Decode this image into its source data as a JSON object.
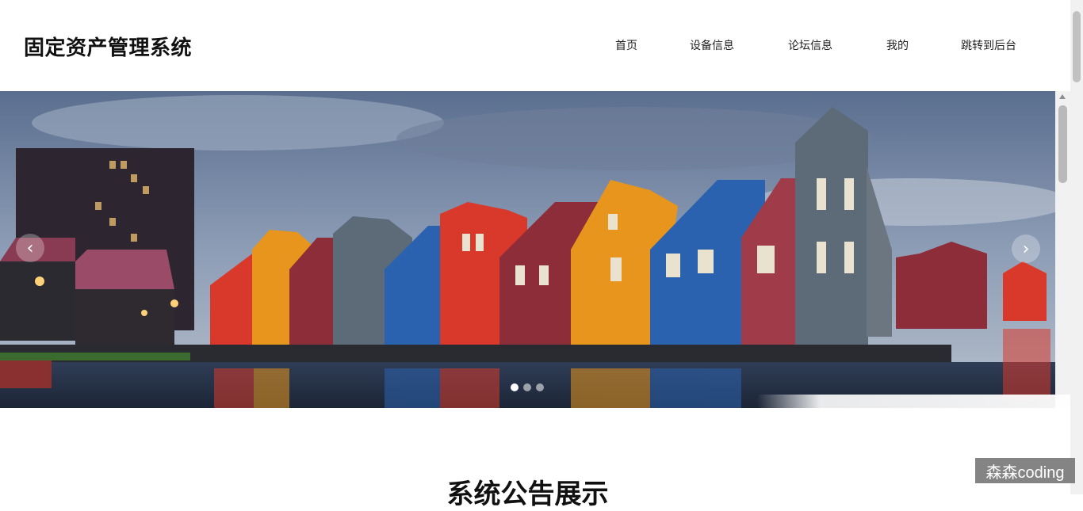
{
  "app": {
    "title": "固定资产管理系统"
  },
  "nav": {
    "items": [
      {
        "label": "首页"
      },
      {
        "label": "设备信息"
      },
      {
        "label": "论坛信息"
      },
      {
        "label": "我的"
      },
      {
        "label": "跳转到后台"
      }
    ]
  },
  "banner": {
    "prev_icon": "chevron-left-icon",
    "next_icon": "chevron-right-icon",
    "prev_glyph": "‹",
    "next_glyph": "›",
    "slides_count": 3,
    "active_slide": 1
  },
  "section": {
    "title": "系统公告展示"
  },
  "watermark": {
    "text": "森森coding"
  },
  "colors": {
    "sky": "#8a9bb5",
    "water": "#3a4d6e",
    "red_house": "#d8392b",
    "orange_house": "#e7951c",
    "blue_house": "#2b62b0",
    "grey_house": "#5d6a77"
  }
}
